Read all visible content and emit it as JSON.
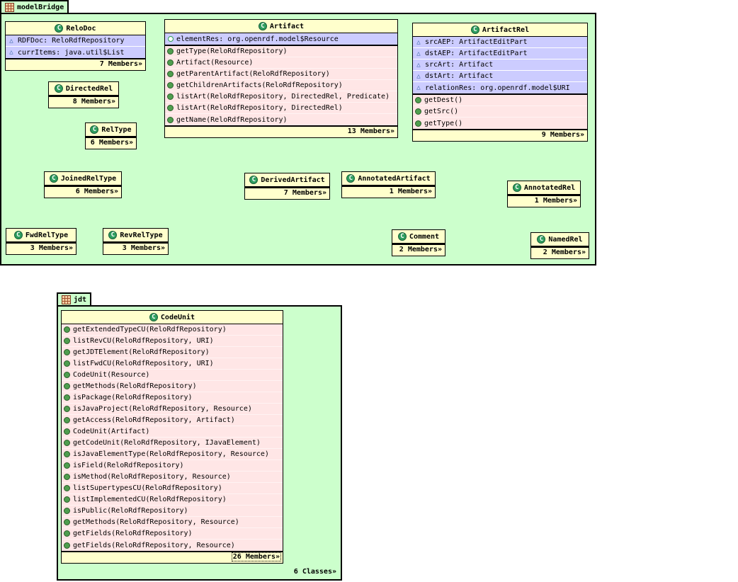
{
  "colors": {
    "package_fill": "#ccffcc",
    "header_fill": "#ffffcc",
    "attribute_fill": "#ccccff",
    "method_fill": "#ffe6e6",
    "border": "#000000",
    "class_icon_green": "#2f9e5f",
    "field_icon_blue": "#3465a4",
    "method_icon_green": "#4f9e4f",
    "package_icon_orange": "#a0512e"
  },
  "icons": {
    "class-icon": "letter C in green circle",
    "package-icon": "orange 3x3 grid square",
    "field-icon": "blue outline triangle",
    "public-field-icon": "green outline circle",
    "method-icon": "green filled circle"
  },
  "packages": [
    {
      "name": "modelBridge",
      "classes": [
        {
          "name": "ReloDoc",
          "attributes": [
            "RDFDoc: ReloRdfRepository",
            "currItems: java.util$List"
          ],
          "methods": [],
          "members": "7 Members»"
        },
        {
          "name": "Artifact",
          "attributes": [
            "elementRes: org.openrdf.model$Resource"
          ],
          "methods": [
            "getType(ReloRdfRepository)",
            "Artifact(Resource)",
            "getParentArtifact(ReloRdfRepository)",
            "getChildrenArtifacts(ReloRdfRepository)",
            "listArt(ReloRdfRepository, DirectedRel, Predicate)",
            "listArt(ReloRdfRepository, DirectedRel)",
            "getName(ReloRdfRepository)"
          ],
          "members": "13 Members»"
        },
        {
          "name": "ArtifactRel",
          "attributes": [
            "srcAEP: ArtifactEditPart",
            "dstAEP: ArtifactEditPart",
            "srcArt: Artifact",
            "dstArt: Artifact",
            "relationRes: org.openrdf.model$URI"
          ],
          "methods": [
            "getDest()",
            "getSrc()",
            "getType()"
          ],
          "members": "9 Members»"
        },
        {
          "name": "DirectedRel",
          "attributes": [],
          "methods": [],
          "members": "8 Members»"
        },
        {
          "name": "RelType",
          "attributes": [],
          "methods": [],
          "members": "6 Members»"
        },
        {
          "name": "JoinedRelType",
          "attributes": [],
          "methods": [],
          "members": "6 Members»"
        },
        {
          "name": "DerivedArtifact",
          "attributes": [],
          "methods": [],
          "members": "7 Members»"
        },
        {
          "name": "AnnotatedArtifact",
          "attributes": [],
          "methods": [],
          "members": "1 Members»"
        },
        {
          "name": "AnnotatedRel",
          "attributes": [],
          "methods": [],
          "members": "1 Members»"
        },
        {
          "name": "FwdRelType",
          "attributes": [],
          "methods": [],
          "members": "3 Members»"
        },
        {
          "name": "RevRelType",
          "attributes": [],
          "methods": [],
          "members": "3 Members»"
        },
        {
          "name": "Comment",
          "attributes": [],
          "methods": [],
          "members": "2 Members»"
        },
        {
          "name": "NamedRel",
          "attributes": [],
          "methods": [],
          "members": "2 Members»"
        }
      ]
    },
    {
      "name": "jdt",
      "footer": "6 Classes»",
      "classes": [
        {
          "name": "CodeUnit",
          "attributes": [],
          "methods": [
            "getExtendedTypeCU(ReloRdfRepository)",
            "listRevCU(ReloRdfRepository, URI)",
            "getJDTElement(ReloRdfRepository)",
            "listFwdCU(ReloRdfRepository, URI)",
            "CodeUnit(Resource)",
            "getMethods(ReloRdfRepository)",
            "isPackage(ReloRdfRepository)",
            "isJavaProject(ReloRdfRepository, Resource)",
            "getAccess(ReloRdfRepository, Artifact)",
            "CodeUnit(Artifact)",
            "getCodeUnit(ReloRdfRepository, IJavaElement)",
            "isJavaElementType(ReloRdfRepository, Resource)",
            "isField(ReloRdfRepository)",
            "isMethod(ReloRdfRepository, Resource)",
            "listSupertypesCU(ReloRdfRepository)",
            "listImplementedCU(ReloRdfRepository)",
            "isPublic(ReloRdfRepository)",
            "getMethods(ReloRdfRepository, Resource)",
            "getFields(ReloRdfRepository)",
            "getFields(ReloRdfRepository, Resource)"
          ],
          "members": "26 Members»"
        }
      ]
    }
  ]
}
